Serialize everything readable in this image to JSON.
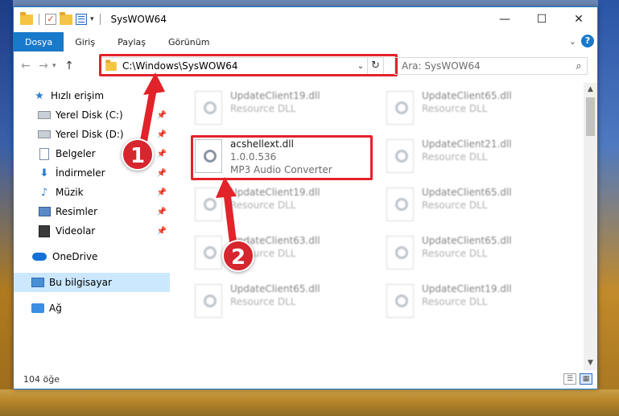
{
  "window": {
    "title": "SysWOW64",
    "controls": {
      "minimize": "—",
      "maximize": "☐",
      "close": "✕"
    }
  },
  "ribbon": {
    "tabs": [
      "Dosya",
      "Giriş",
      "Paylaş",
      "Görünüm"
    ],
    "help": "?",
    "expand": "⌄"
  },
  "nav": {
    "back": "←",
    "forward": "→",
    "recent": "▾",
    "up": "↑",
    "address": "C:\\Windows\\SysWOW64",
    "address_dropdown": "⌄",
    "refresh": "↻",
    "search_placeholder": "Ara: SysWOW64",
    "search_icon": "⌕"
  },
  "sidebar": {
    "items": [
      {
        "label": "Hızlı erişim",
        "icon": "star-icon",
        "pinned": false
      },
      {
        "label": "Yerel Disk (C:)",
        "icon": "disk-icon",
        "pinned": true
      },
      {
        "label": "Yerel Disk (D:)",
        "icon": "disk-icon",
        "pinned": true
      },
      {
        "label": "Belgeler",
        "icon": "documents-icon",
        "pinned": true
      },
      {
        "label": "İndirmeler",
        "icon": "downloads-icon",
        "pinned": true
      },
      {
        "label": "Müzik",
        "icon": "music-icon",
        "pinned": true
      },
      {
        "label": "Resimler",
        "icon": "pictures-icon",
        "pinned": true
      },
      {
        "label": "Videolar",
        "icon": "videos-icon",
        "pinned": true
      },
      {
        "label": "OneDrive",
        "icon": "onedrive-icon",
        "pinned": false
      },
      {
        "label": "Bu bilgisayar",
        "icon": "this-pc-icon",
        "pinned": false,
        "selected": true
      },
      {
        "label": "Ağ",
        "icon": "network-icon",
        "pinned": false
      }
    ],
    "pin_glyph": "📌"
  },
  "files": {
    "left": [
      {
        "name": "UpdateClient19.dll",
        "sub": "Resource DLL",
        "blurred": true
      },
      {
        "name": "acshellext.dll",
        "version": "1.0.0.536",
        "sub": "MP3 Audio Converter",
        "blurred": false
      },
      {
        "name": "UpdateClient19.dll",
        "sub": "Resource DLL",
        "blurred": true
      },
      {
        "name": "UpdateClient63.dll",
        "sub": "Resource DLL",
        "blurred": true
      },
      {
        "name": "UpdateClient65.dll",
        "sub": "Resource DLL",
        "blurred": true
      }
    ],
    "right": [
      {
        "name": "UpdateClient65.dll",
        "sub": "Resource DLL",
        "blurred": true
      },
      {
        "name": "UpdateClient21.dll",
        "sub": "Resource DLL",
        "blurred": true
      },
      {
        "name": "UpdateClient65.dll",
        "sub": "Resource DLL",
        "blurred": true
      },
      {
        "name": "UpdateClient65.dll",
        "sub": "Resource DLL",
        "blurred": true
      },
      {
        "name": "UpdateClient19.dll",
        "sub": "Resource DLL",
        "blurred": true
      }
    ]
  },
  "status": {
    "item_count": "104 öğe"
  },
  "annotations": {
    "badge1": "1",
    "badge2": "2"
  },
  "colors": {
    "accent": "#1979ca",
    "highlight": "#e2232a",
    "selected": "#cce8ff"
  }
}
